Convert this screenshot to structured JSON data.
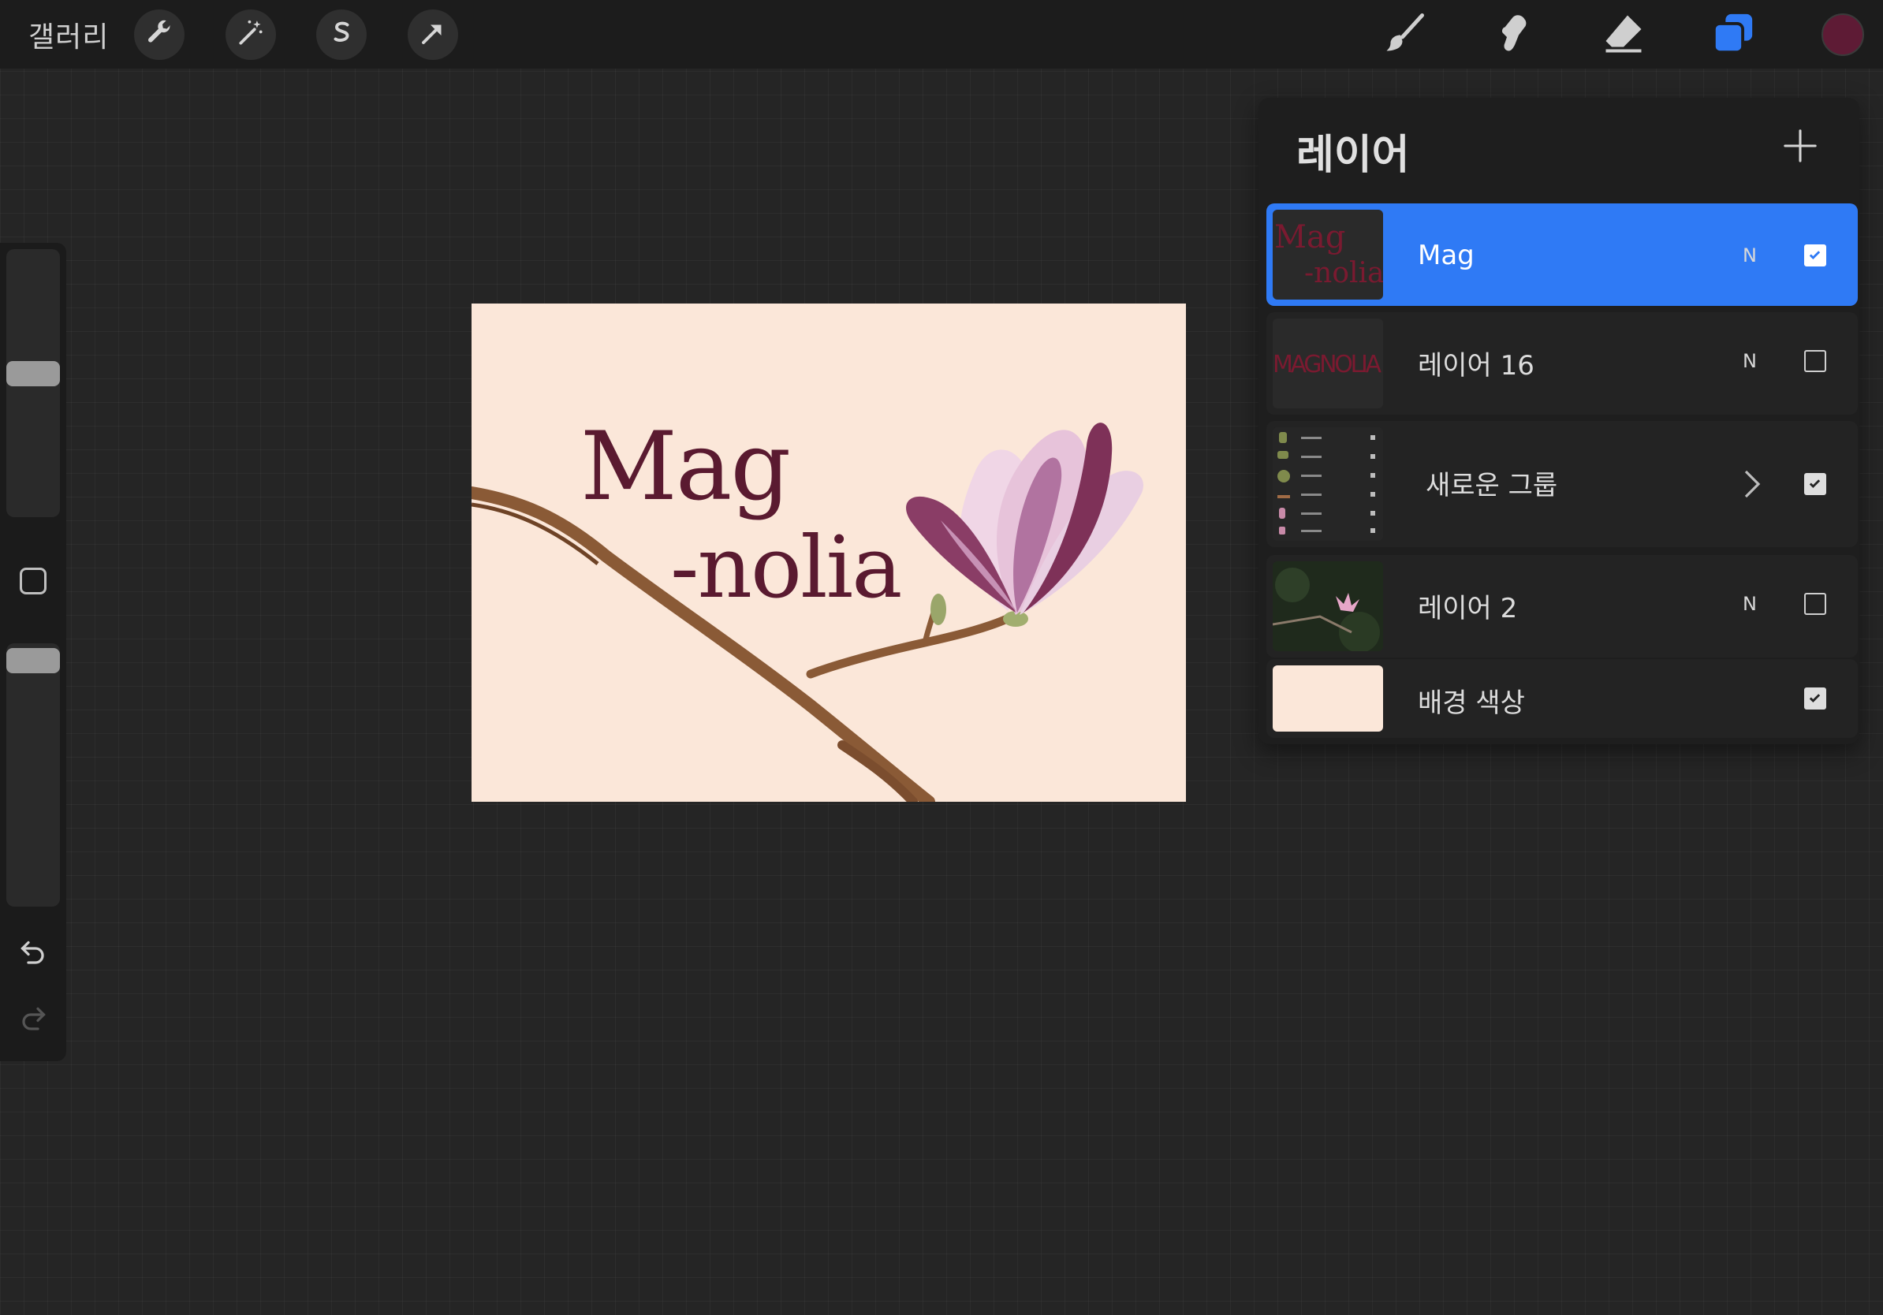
{
  "toolbar": {
    "gallery_label": "갤러리",
    "left_icons": [
      "wrench-icon",
      "magic-wand-icon",
      "selection-s-icon",
      "transform-arrow-icon"
    ],
    "right_icons": [
      "brush-icon",
      "smudge-icon",
      "eraser-icon",
      "layers-icon"
    ],
    "current_color": "#5e1b35",
    "accent_color": "#2f7af5"
  },
  "sidebar": {
    "brush_size_level": 0.47,
    "opacity_level": 0.95,
    "icons": [
      "modify-square-icon",
      "undo-icon",
      "redo-icon"
    ]
  },
  "artwork": {
    "line1": "Mag",
    "line2": "-nolia",
    "background_color": "#fbe7d9",
    "text_color": "#5a1a30"
  },
  "layers_panel": {
    "title": "레이어",
    "add_icon": "plus-icon",
    "layers": [
      {
        "name": "Mag",
        "blend": "N",
        "visible": true,
        "selected": true,
        "thumb_text": "Mag -nolia"
      },
      {
        "name": "레이어 16",
        "blend": "N",
        "visible": false,
        "selected": false,
        "thumb_text": "MAGNOLIA"
      },
      {
        "name": "새로운 그룹",
        "blend": "",
        "visible": true,
        "selected": false,
        "is_group": true
      },
      {
        "name": "레이어 2",
        "blend": "N",
        "visible": false,
        "selected": false
      },
      {
        "name": "배경 색상",
        "blend": "",
        "visible": true,
        "selected": false
      }
    ]
  }
}
